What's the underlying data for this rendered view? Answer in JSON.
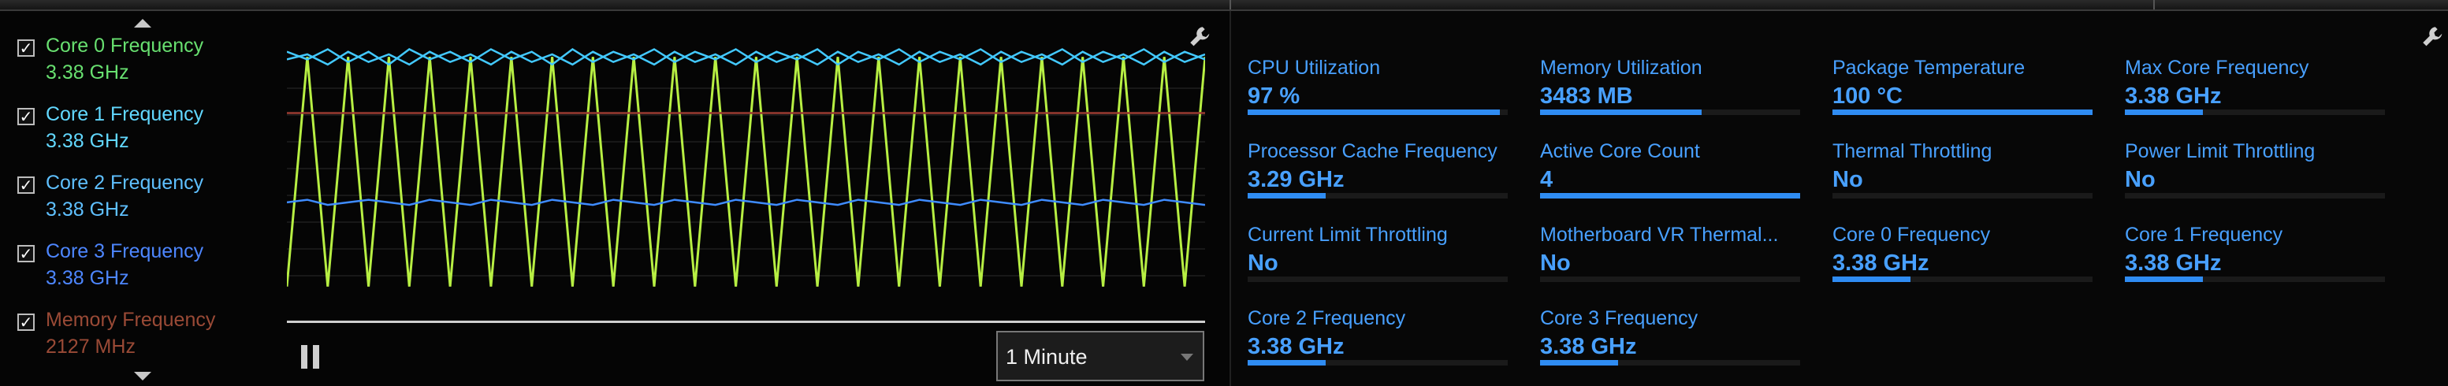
{
  "window": {
    "title": ""
  },
  "sensors": [
    {
      "label": "Core 0 Frequency",
      "value": "3.38 GHz",
      "checked": true,
      "color": "#68e070"
    },
    {
      "label": "Core 1 Frequency",
      "value": "3.38 GHz",
      "checked": true,
      "color": "#62d8ff"
    },
    {
      "label": "Core 2 Frequency",
      "value": "3.38 GHz",
      "checked": true,
      "color": "#5fc0ff"
    },
    {
      "label": "Core 3 Frequency",
      "value": "3.38 GHz",
      "checked": true,
      "color": "#4d86ff"
    },
    {
      "label": "Memory Frequency",
      "value": "2127 MHz",
      "checked": true,
      "color": "#9a4a36"
    }
  ],
  "graph": {
    "controls": {
      "pause_icon": "pause-icon",
      "wrench_icon": "wrench-icon",
      "timespan_value": "1 Minute"
    },
    "colors": {
      "core_spikes": "#b7ef43",
      "upper_line": "#43c9ff",
      "middle_line": "#3f8cff",
      "memory_line": "#9a3b31",
      "grid": "#2c2c2c"
    },
    "chart_data": {
      "type": "line",
      "series": [
        {
          "name": "Core 0 Frequency",
          "values": [
            0.05,
            0.95,
            0.05,
            0.95,
            0.05,
            0.95,
            0.05,
            0.95,
            0.05,
            0.95,
            0.05,
            0.95,
            0.05,
            0.95,
            0.05,
            0.95,
            0.05,
            0.95,
            0.05,
            0.95,
            0.05,
            0.95,
            0.05,
            0.95,
            0.05,
            0.95,
            0.05,
            0.95,
            0.05,
            0.95,
            0.05,
            0.95,
            0.05,
            0.95,
            0.05,
            0.95,
            0.05,
            0.95,
            0.05,
            0.95,
            0.05,
            0.95,
            0.05,
            0.95,
            0.05,
            0.95
          ]
        },
        {
          "name": "Core 1 Frequency",
          "values": [
            0.97,
            0.94,
            0.98,
            0.93,
            0.97,
            0.92,
            0.98,
            0.94,
            0.97,
            0.93,
            0.98,
            0.94,
            0.97,
            0.92,
            0.98,
            0.93,
            0.97,
            0.94,
            0.98,
            0.93,
            0.97,
            0.94,
            0.98,
            0.93,
            0.97,
            0.94,
            0.98,
            0.92,
            0.97,
            0.94,
            0.98,
            0.93,
            0.97,
            0.94,
            0.98,
            0.93,
            0.97,
            0.94,
            0.98,
            0.93,
            0.97,
            0.94,
            0.98,
            0.93,
            0.97,
            0.94
          ]
        },
        {
          "name": "Core 2 Frequency",
          "values": [
            0.94,
            0.96,
            0.92,
            0.97,
            0.93,
            0.96,
            0.92,
            0.97,
            0.93,
            0.96,
            0.92,
            0.97,
            0.93,
            0.96,
            0.92,
            0.97,
            0.93,
            0.96,
            0.92,
            0.97,
            0.93,
            0.96,
            0.92,
            0.97,
            0.93,
            0.96,
            0.92,
            0.97,
            0.93,
            0.96,
            0.92,
            0.97,
            0.93,
            0.96,
            0.92,
            0.97,
            0.93,
            0.96,
            0.92,
            0.97,
            0.93,
            0.96,
            0.92,
            0.97,
            0.93,
            0.96
          ]
        },
        {
          "name": "Core 3 Frequency",
          "values": [
            0.38,
            0.39,
            0.37,
            0.38,
            0.39,
            0.38,
            0.37,
            0.39,
            0.38,
            0.37,
            0.39,
            0.38,
            0.37,
            0.39,
            0.38,
            0.37,
            0.39,
            0.38,
            0.37,
            0.39,
            0.38,
            0.37,
            0.39,
            0.38,
            0.37,
            0.39,
            0.38,
            0.37,
            0.39,
            0.38,
            0.37,
            0.39,
            0.38,
            0.37,
            0.39,
            0.38,
            0.37,
            0.39,
            0.38,
            0.37,
            0.39,
            0.38,
            0.37,
            0.39,
            0.38,
            0.37
          ]
        },
        {
          "name": "Memory Frequency",
          "values": [
            0.73,
            0.73,
            0.73,
            0.73,
            0.73,
            0.73,
            0.73,
            0.73,
            0.73,
            0.73,
            0.73,
            0.73,
            0.73,
            0.73,
            0.73,
            0.73,
            0.73,
            0.73,
            0.73,
            0.73,
            0.73,
            0.73,
            0.73,
            0.73,
            0.73,
            0.73,
            0.73,
            0.73,
            0.73,
            0.73,
            0.73,
            0.73,
            0.73,
            0.73,
            0.73,
            0.73,
            0.73,
            0.73,
            0.73,
            0.73,
            0.73,
            0.73,
            0.73,
            0.73,
            0.73,
            0.73
          ]
        }
      ],
      "ylim": [
        0,
        1
      ],
      "grid": true
    }
  },
  "metrics": [
    {
      "title": "CPU Utilization",
      "value": "97 %",
      "level": 0.97
    },
    {
      "title": "Memory Utilization",
      "value": "3483  MB",
      "level": 0.62
    },
    {
      "title": "Package Temperature",
      "value": "100 °C",
      "level": 1.0
    },
    {
      "title": "Max Core Frequency",
      "value": "3.38 GHz",
      "level": 0.3
    },
    {
      "title": "Processor Cache Frequency",
      "value": "3.29 GHz",
      "level": 0.3
    },
    {
      "title": "Active Core Count",
      "value": "4",
      "level": 1.0
    },
    {
      "title": "Thermal Throttling",
      "value": "No",
      "level": 0
    },
    {
      "title": "Power Limit Throttling",
      "value": "No",
      "level": 0
    },
    {
      "title": "Current Limit Throttling",
      "value": "No",
      "level": 0
    },
    {
      "title": "Motherboard VR Thermal...",
      "value": "No",
      "level": 0
    },
    {
      "title": "Core 0 Frequency",
      "value": "3.38 GHz",
      "level": 0.3
    },
    {
      "title": "Core 1 Frequency",
      "value": "3.38 GHz",
      "level": 0.3
    },
    {
      "title": "Core 2 Frequency",
      "value": "3.38 GHz",
      "level": 0.3
    },
    {
      "title": "Core 3 Frequency",
      "value": "3.38 GHz",
      "level": 0.3
    }
  ]
}
